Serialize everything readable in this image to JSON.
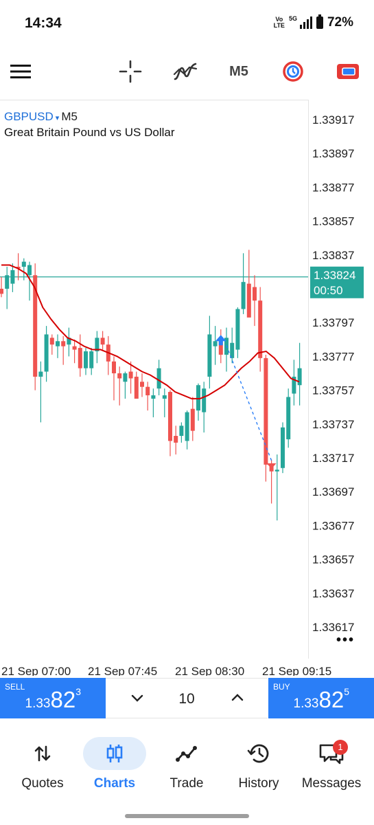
{
  "status_bar": {
    "time": "14:34",
    "volte_top": "Vo",
    "volte_bottom": "LTE",
    "network": "5G",
    "battery": "72%"
  },
  "toolbar": {
    "timeframe": "M5",
    "icons": [
      "menu-icon",
      "crosshair-icon",
      "indicators-icon",
      "timeframe-label",
      "one-click-trading-icon",
      "trade-mode-icon"
    ],
    "colors": {
      "clock_icon": "#e53935",
      "trade_icon": "#e53935"
    }
  },
  "chart": {
    "symbol": "GBPUSD",
    "caret": "▾",
    "timeframe": "M5",
    "description": "Great Britain Pound vs US Dollar",
    "current_price_label": "1.33824",
    "countdown_label": "00:50",
    "more": "•••",
    "colors": {
      "bull": "#26a69a",
      "bear": "#ef5350",
      "ma": "#d50000",
      "bid_line": "#26a69a",
      "arrow_buy": "#2a7ef7",
      "arrow_sell": "#ef5350"
    }
  },
  "chart_data": {
    "type": "candlestick",
    "symbol": "GBPUSD",
    "timeframe": "M5",
    "ylim": [
      1.33607,
      1.33927
    ],
    "y_ticks": [
      "1.33917",
      "1.33897",
      "1.33877",
      "1.33857",
      "1.33837",
      "1.33817",
      "1.33797",
      "1.33777",
      "1.33757",
      "1.33737",
      "1.33717",
      "1.33697",
      "1.33677",
      "1.33657",
      "1.33637",
      "1.33617"
    ],
    "x_ticks": [
      "21 Sep 07:00",
      "21 Sep 07:45",
      "21 Sep 08:30",
      "21 Sep 09:15"
    ],
    "current_price": 1.33824,
    "candles": [
      {
        "o": 1.33817,
        "h": 1.33824,
        "l": 1.33812,
        "c": 1.33814
      },
      {
        "o": 1.33817,
        "h": 1.3383,
        "l": 1.33805,
        "c": 1.33825
      },
      {
        "o": 1.3382,
        "h": 1.33832,
        "l": 1.33815,
        "c": 1.33828
      },
      {
        "o": 1.3383,
        "h": 1.33838,
        "l": 1.33822,
        "c": 1.33829
      },
      {
        "o": 1.3383,
        "h": 1.33835,
        "l": 1.33822,
        "c": 1.33833
      },
      {
        "o": 1.33825,
        "h": 1.33833,
        "l": 1.3381,
        "c": 1.33831
      },
      {
        "o": 1.33825,
        "h": 1.33832,
        "l": 1.33757,
        "c": 1.33765
      },
      {
        "o": 1.33765,
        "h": 1.33774,
        "l": 1.33738,
        "c": 1.33768
      },
      {
        "o": 1.33768,
        "h": 1.33795,
        "l": 1.33762,
        "c": 1.3379
      },
      {
        "o": 1.33788,
        "h": 1.3379,
        "l": 1.33778,
        "c": 1.33784
      },
      {
        "o": 1.33783,
        "h": 1.3379,
        "l": 1.33776,
        "c": 1.33786
      },
      {
        "o": 1.33786,
        "h": 1.33789,
        "l": 1.33772,
        "c": 1.33783
      },
      {
        "o": 1.33784,
        "h": 1.33794,
        "l": 1.33777,
        "c": 1.33788
      },
      {
        "o": 1.33783,
        "h": 1.33787,
        "l": 1.33773,
        "c": 1.33781
      },
      {
        "o": 1.33782,
        "h": 1.3379,
        "l": 1.33765,
        "c": 1.3377
      },
      {
        "o": 1.3377,
        "h": 1.33782,
        "l": 1.33766,
        "c": 1.3378
      },
      {
        "o": 1.3377,
        "h": 1.33782,
        "l": 1.33766,
        "c": 1.3378
      },
      {
        "o": 1.3378,
        "h": 1.33792,
        "l": 1.33773,
        "c": 1.33788
      },
      {
        "o": 1.33788,
        "h": 1.33792,
        "l": 1.33781,
        "c": 1.33784
      },
      {
        "o": 1.33784,
        "h": 1.33789,
        "l": 1.33766,
        "c": 1.33774
      },
      {
        "o": 1.33774,
        "h": 1.33777,
        "l": 1.33751,
        "c": 1.33767
      },
      {
        "o": 1.33767,
        "h": 1.33771,
        "l": 1.33748,
        "c": 1.33764
      },
      {
        "o": 1.33762,
        "h": 1.33768,
        "l": 1.33752,
        "c": 1.33767
      },
      {
        "o": 1.33768,
        "h": 1.33774,
        "l": 1.33755,
        "c": 1.33764
      },
      {
        "o": 1.33765,
        "h": 1.33768,
        "l": 1.33753,
        "c": 1.33752
      },
      {
        "o": 1.33762,
        "h": 1.33767,
        "l": 1.33753,
        "c": 1.33759
      },
      {
        "o": 1.33759,
        "h": 1.33762,
        "l": 1.33745,
        "c": 1.33754
      },
      {
        "o": 1.33752,
        "h": 1.33758,
        "l": 1.33741,
        "c": 1.33754
      },
      {
        "o": 1.33758,
        "h": 1.33775,
        "l": 1.33754,
        "c": 1.3377
      },
      {
        "o": 1.33752,
        "h": 1.33758,
        "l": 1.33741,
        "c": 1.33754
      },
      {
        "o": 1.33756,
        "h": 1.33757,
        "l": 1.33718,
        "c": 1.33727
      },
      {
        "o": 1.3373,
        "h": 1.33736,
        "l": 1.33719,
        "c": 1.33726
      },
      {
        "o": 1.3373,
        "h": 1.33738,
        "l": 1.33726,
        "c": 1.33736
      },
      {
        "o": 1.33727,
        "h": 1.33745,
        "l": 1.33722,
        "c": 1.33744
      },
      {
        "o": 1.33746,
        "h": 1.33753,
        "l": 1.33727,
        "c": 1.33733
      },
      {
        "o": 1.33745,
        "h": 1.33761,
        "l": 1.33739,
        "c": 1.3376
      },
      {
        "o": 1.33744,
        "h": 1.33762,
        "l": 1.33732,
        "c": 1.33758
      },
      {
        "o": 1.33765,
        "h": 1.33801,
        "l": 1.33758,
        "c": 1.3379
      },
      {
        "o": 1.33783,
        "h": 1.33795,
        "l": 1.33772,
        "c": 1.33786
      },
      {
        "o": 1.33786,
        "h": 1.33793,
        "l": 1.33773,
        "c": 1.33778
      },
      {
        "o": 1.33778,
        "h": 1.33794,
        "l": 1.33768,
        "c": 1.33788
      },
      {
        "o": 1.33776,
        "h": 1.33794,
        "l": 1.33773,
        "c": 1.33785
      },
      {
        "o": 1.33781,
        "h": 1.33806,
        "l": 1.33776,
        "c": 1.33805
      },
      {
        "o": 1.33805,
        "h": 1.33838,
        "l": 1.33802,
        "c": 1.33821
      },
      {
        "o": 1.3382,
        "h": 1.3384,
        "l": 1.33811,
        "c": 1.338
      },
      {
        "o": 1.33818,
        "h": 1.33825,
        "l": 1.33795,
        "c": 1.3381
      },
      {
        "o": 1.3381,
        "h": 1.33818,
        "l": 1.33768,
        "c": 1.33776
      },
      {
        "o": 1.33776,
        "h": 1.33778,
        "l": 1.33703,
        "c": 1.33713
      },
      {
        "o": 1.33713,
        "h": 1.33716,
        "l": 1.3369,
        "c": 1.33709
      },
      {
        "o": 1.33709,
        "h": 1.33719,
        "l": 1.3368,
        "c": 1.3371
      },
      {
        "o": 1.33711,
        "h": 1.33738,
        "l": 1.33708,
        "c": 1.33735
      },
      {
        "o": 1.33728,
        "h": 1.33758,
        "l": 1.33723,
        "c": 1.33753
      },
      {
        "o": 1.33755,
        "h": 1.33775,
        "l": 1.33748,
        "c": 1.33765
      },
      {
        "o": 1.3376,
        "h": 1.33785,
        "l": 1.33748,
        "c": 1.3377
      }
    ],
    "moving_average": [
      1.33831,
      1.33831,
      1.33829,
      1.33826,
      1.33818,
      1.33806,
      1.33799,
      1.33793,
      1.33788,
      1.33786,
      1.33783,
      1.33781,
      1.33781,
      1.33779,
      1.33777,
      1.33774,
      1.33771,
      1.33768,
      1.33766,
      1.33763,
      1.3376,
      1.33756,
      1.33754,
      1.33752,
      1.33752,
      1.33754,
      1.33757,
      1.3376,
      1.33765,
      1.3377,
      1.33774,
      1.33779,
      1.3378,
      1.33776,
      1.3377,
      1.33764,
      1.33762
    ],
    "trade_markers": [
      {
        "type": "buy",
        "price": 1.33786
      },
      {
        "type": "sell",
        "price": 1.33713
      }
    ]
  },
  "order_panel": {
    "sell": {
      "label": "SELL",
      "price_prefix": "1.33",
      "price_big": "82",
      "price_sup": "3"
    },
    "buy": {
      "label": "BUY",
      "price_prefix": "1.33",
      "price_big": "82",
      "price_sup": "5"
    },
    "volume": "10"
  },
  "bottom_nav": {
    "items": [
      {
        "label": "Quotes",
        "icon": "quotes-icon"
      },
      {
        "label": "Charts",
        "icon": "charts-icon",
        "active": true
      },
      {
        "label": "Trade",
        "icon": "trade-icon"
      },
      {
        "label": "History",
        "icon": "history-icon"
      },
      {
        "label": "Messages",
        "icon": "messages-icon",
        "badge": "1"
      }
    ],
    "active_color": "#2a7ef7"
  }
}
